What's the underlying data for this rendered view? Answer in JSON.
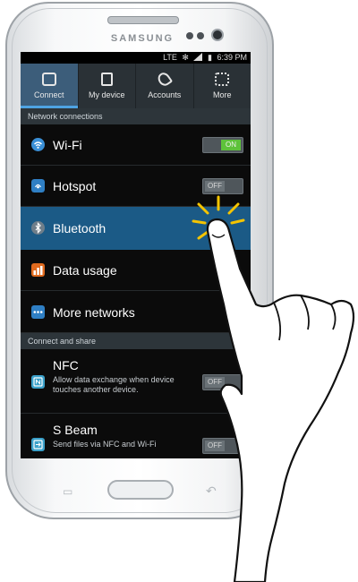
{
  "device": {
    "brand": "SAMSUNG"
  },
  "statusbar": {
    "network": "LTE",
    "time": "6:39 PM"
  },
  "tabs": [
    {
      "label": "Connect",
      "icon": "connect-icon",
      "active": true
    },
    {
      "label": "My device",
      "icon": "device-icon",
      "active": false
    },
    {
      "label": "Accounts",
      "icon": "key-icon",
      "active": false
    },
    {
      "label": "More",
      "icon": "more-icon",
      "active": false
    }
  ],
  "sections": {
    "network": "Network connections",
    "share": "Connect and share"
  },
  "items": {
    "wifi": {
      "label": "Wi-Fi",
      "toggle": "ON",
      "icon": "wifi-icon"
    },
    "hotspot": {
      "label": "Hotspot",
      "toggle": "OFF",
      "icon": "hotspot-icon"
    },
    "bluetooth": {
      "label": "Bluetooth",
      "icon": "bluetooth-icon",
      "selected": true
    },
    "data_usage": {
      "label": "Data usage",
      "icon": "data-usage-icon"
    },
    "more_networks": {
      "label": "More networks",
      "icon": "more-networks-icon"
    },
    "nfc": {
      "label": "NFC",
      "description": "Allow data exchange when device touches another device.",
      "toggle": "OFF",
      "icon": "nfc-icon"
    },
    "sbeam": {
      "label": "S Beam",
      "description": "Send files via NFC and Wi-Fi",
      "toggle": "OFF",
      "icon": "sbeam-icon"
    }
  },
  "colors": {
    "selected_row": "#1b5a86",
    "active_tab": "#3c5d7a",
    "toggle_on": "#5ec23a",
    "tap_burst": "#f5c400"
  }
}
